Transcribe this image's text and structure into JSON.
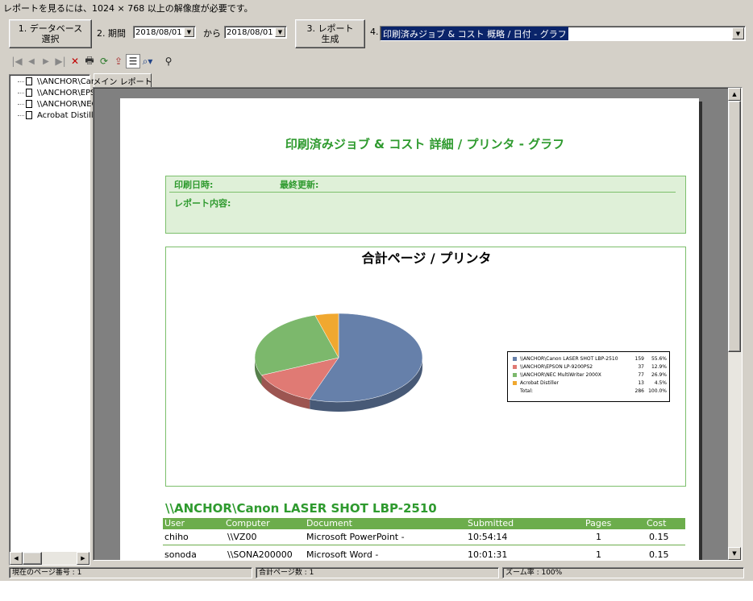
{
  "notice": "レポートを見るには、1024 × 768 以上の解像度が必要です。",
  "toolbar": {
    "step1": "1. データベース\n選択",
    "step2_label": "2. 期間",
    "from_date": "2018/08/01",
    "kara": "から",
    "to_date": "2018/08/01",
    "step3": "3. レポート\n生成",
    "step4_label": "4.",
    "report_select": "印刷済みジョブ & コスト 概略 / 日付 - グラフ"
  },
  "icons": [
    "first-page-icon",
    "prev-page-icon",
    "next-page-icon",
    "last-page-icon",
    "close-icon",
    "print-icon",
    "refresh-icon",
    "export-icon",
    "tree-toggle-icon",
    "zoom-icon",
    "search-icon"
  ],
  "tree": {
    "items": [
      "\\\\ANCHOR\\Canon",
      "\\\\ANCHOR\\EPSON",
      "\\\\ANCHOR\\NEC",
      "Acrobat Distiller"
    ]
  },
  "tab": "メイン レポート",
  "report": {
    "title": "印刷済みジョブ & コスト 詳細 / プリンタ - グラフ",
    "print_date_label": "印刷日時:",
    "last_update_label": "最終更新:",
    "content_label": "レポート内容:",
    "section_title": "\\\\ANCHOR\\Canon LASER SHOT LBP-2510",
    "columns": [
      "User",
      "Computer",
      "Document",
      "Submitted",
      "Pages",
      "Cost"
    ],
    "rows": [
      [
        "chiho",
        "\\\\VZ00",
        "Microsoft PowerPoint -",
        "10:54:14",
        "1",
        "0.15"
      ],
      [
        "sonoda",
        "\\\\SONA200000",
        "Microsoft Word -",
        "10:01:31",
        "1",
        "0.15"
      ]
    ]
  },
  "chart_data": {
    "type": "pie",
    "title": "合計ページ / プリンタ",
    "categories": [
      "\\\\ANCHOR\\Canon LASER SHOT LBP-2510",
      "\\\\ANCHOR\\EPSON LP-9200PS2",
      "\\\\ANCHOR\\NEC MultiWriter 2000X",
      "Acrobat Distiller"
    ],
    "values": [
      159,
      37,
      77,
      13
    ],
    "percents": [
      "55.6%",
      "12.9%",
      "26.9%",
      "4.5%"
    ],
    "total_label": "Total:",
    "total_value": "286",
    "total_percent": "100.0%",
    "colors": [
      "#6680aa",
      "#e07a74",
      "#7cb86c",
      "#f0a830"
    ],
    "legend": "right"
  },
  "status": {
    "current_page": "現在のページ番号 : 1",
    "total_pages": "合計ページ数 : 1",
    "zoom": "ズーム率 : 100%"
  }
}
